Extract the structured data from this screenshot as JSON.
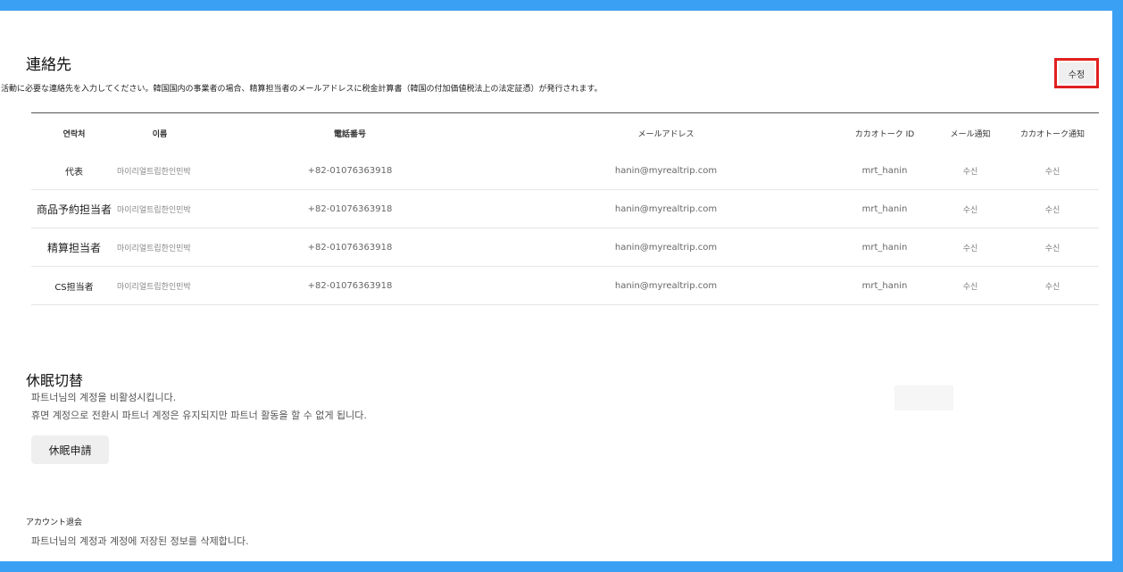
{
  "contact": {
    "title": "連絡先",
    "description": "ー活動に必要な連絡先を入力してください。韓国国内の事業者の場合、精算担当者のメールアドレスに税金計算書（韓国の付加価値税法上の法定証憑）が発行されます。",
    "edit_label": "수정",
    "headers": [
      "연락처",
      "이름",
      "電話番号",
      "メールアドレス",
      "カカオトーク ID",
      "メール通知",
      "カカオトーク通知"
    ],
    "rows": [
      {
        "type": "代表",
        "name": "마이리얼트립한인민박",
        "phone": "+82-01076363918",
        "email": "hanin@myrealtrip.com",
        "kakao": "mrt_hanin",
        "mail_notify": "수신",
        "kakao_notify": "수신"
      },
      {
        "type": "商品予約担当者",
        "name": "마이리얼트립한인민박",
        "phone": "+82-01076363918",
        "email": "hanin@myrealtrip.com",
        "kakao": "mrt_hanin",
        "mail_notify": "수신",
        "kakao_notify": "수신"
      },
      {
        "type": "精算担当者",
        "name": "마이리얼트립한인민박",
        "phone": "+82-01076363918",
        "email": "hanin@myrealtrip.com",
        "kakao": "mrt_hanin",
        "mail_notify": "수신",
        "kakao_notify": "수신"
      },
      {
        "type": "CS担当者",
        "name": "마이리얼트립한인민박",
        "phone": "+82-01076363918",
        "email": "hanin@myrealtrip.com",
        "kakao": "mrt_hanin",
        "mail_notify": "수신",
        "kakao_notify": "수신"
      }
    ]
  },
  "sleep": {
    "title": "休眠切替",
    "line1": "파트너님의 계정을 비활성시킵니다.",
    "line2": "휴면 계정으로 전환시 파트너 계정은 유지되지만 파트너 활동을 할 수 없게 됩니다.",
    "button_label": "休眠申請"
  },
  "withdraw": {
    "title": "アカウント退会",
    "description": "파트너님의 계정과 계정에 저장된 정보를 삭제합니다."
  },
  "colors": {
    "frame_border": "#3aa0f4",
    "highlight": "#e02020"
  }
}
